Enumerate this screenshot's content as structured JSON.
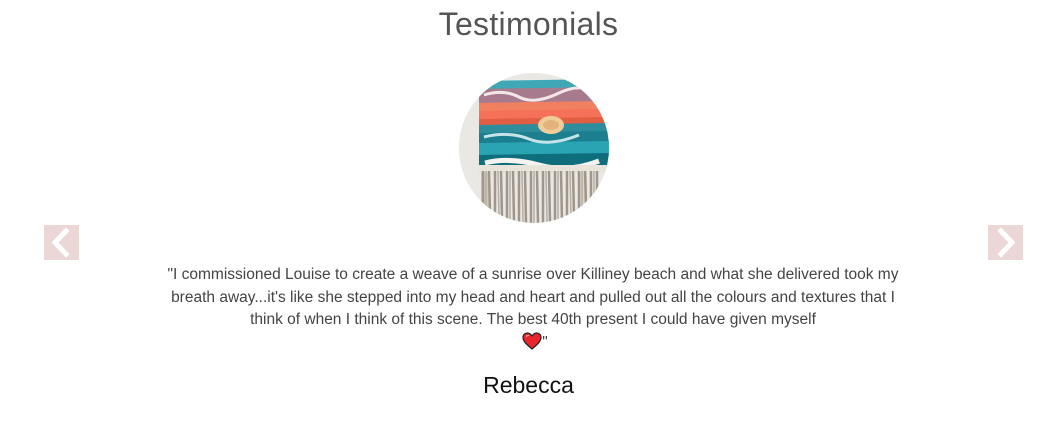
{
  "testimonials": {
    "heading": "Testimonials",
    "quote_text": "\"I commissioned Louise to create a weave of a sunrise over Killiney beach and what she delivered took my breath away...it's like she stepped into my head and heart and pulled out all the colours and textures that I think of when I think of this scene. The best 40th present I could have given myself",
    "quote_end": "\"",
    "emoji": "red-heart",
    "author": "Rebecca",
    "photo": "woven-wall-hanging-photo",
    "prev_icon": "chevron-left-icon",
    "next_icon": "chevron-right-icon",
    "arrow_color": "#ecd7d7"
  }
}
